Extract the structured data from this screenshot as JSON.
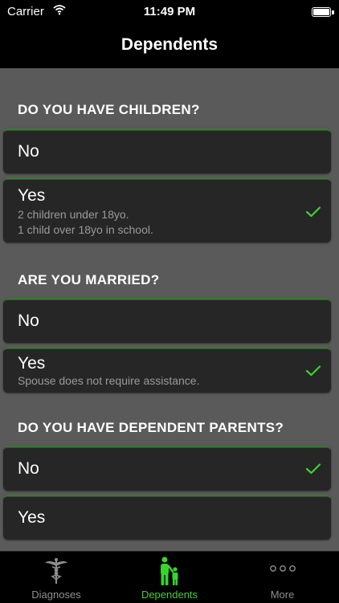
{
  "status_bar": {
    "carrier": "Carrier",
    "time": "11:49 PM"
  },
  "nav": {
    "title": "Dependents"
  },
  "sections": [
    {
      "header": "DO YOU HAVE CHILDREN?",
      "options": [
        {
          "label": "No",
          "sub": [],
          "selected": false
        },
        {
          "label": "Yes",
          "sub": [
            "2 children under 18yo.",
            "1 child over 18yo in school."
          ],
          "selected": true
        }
      ]
    },
    {
      "header": "ARE YOU MARRIED?",
      "options": [
        {
          "label": "No",
          "sub": [],
          "selected": false
        },
        {
          "label": "Yes",
          "sub": [
            "Spouse does not require assistance."
          ],
          "selected": true
        }
      ]
    },
    {
      "header": "DO YOU HAVE DEPENDENT PARENTS?",
      "options": [
        {
          "label": "No",
          "sub": [],
          "selected": true
        },
        {
          "label": "Yes",
          "sub": [],
          "selected": false
        }
      ]
    }
  ],
  "tabs": [
    {
      "label": "Diagnoses",
      "icon": "caduceus-icon",
      "active": false
    },
    {
      "label": "Dependents",
      "icon": "parent-child-icon",
      "active": true
    },
    {
      "label": "More",
      "icon": "more-dots-icon",
      "active": false
    }
  ],
  "colors": {
    "accent": "#39d52b",
    "inactive_tab": "#8e8e8e",
    "background": "#5a5a5a",
    "row": "#262626"
  }
}
